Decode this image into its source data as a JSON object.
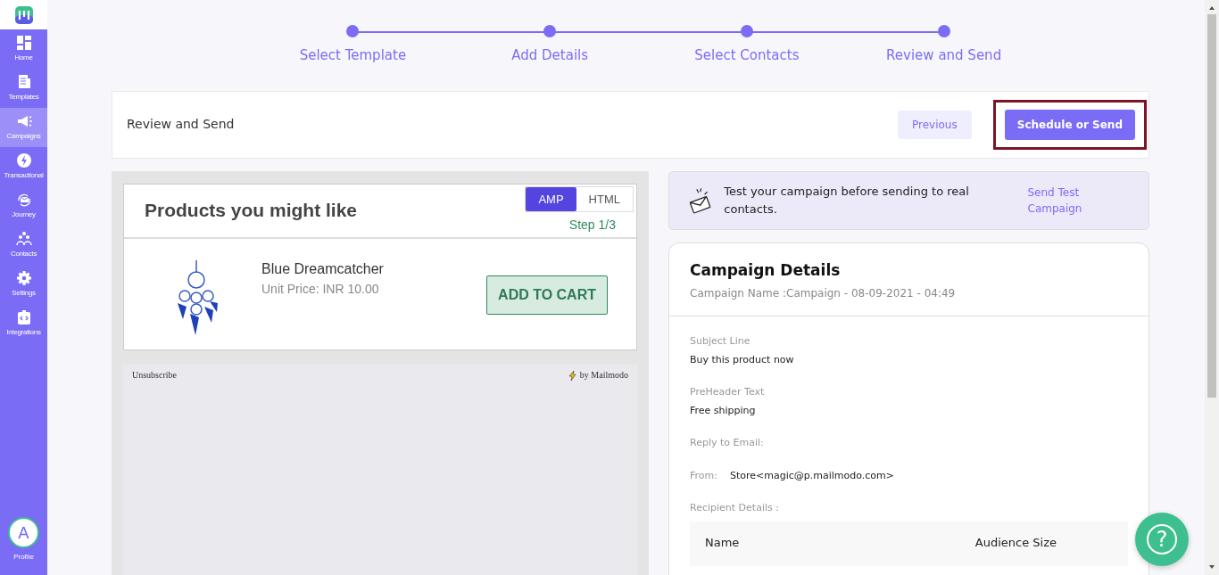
{
  "sidebar": {
    "items": [
      {
        "label": "Home",
        "selected": false
      },
      {
        "label": "Templates",
        "selected": false
      },
      {
        "label": "Campaigns",
        "selected": true
      },
      {
        "label": "Transactional",
        "selected": false
      },
      {
        "label": "Journey",
        "selected": false
      },
      {
        "label": "Contacts",
        "selected": false
      },
      {
        "label": "Settings",
        "selected": false
      },
      {
        "label": "Integrations",
        "selected": false
      }
    ],
    "profile": {
      "initial": "A",
      "label": "Profile"
    }
  },
  "stepper": [
    {
      "label": "Select Template"
    },
    {
      "label": "Add Details"
    },
    {
      "label": "Select Contacts"
    },
    {
      "label": "Review and Send"
    }
  ],
  "header": {
    "title": "Review and Send",
    "buttons": [
      {
        "label": "Previous",
        "kind": "secondary"
      },
      {
        "label": "Schedule or Send",
        "kind": "primary"
      }
    ]
  },
  "preview": {
    "toggle": [
      {
        "label": "AMP",
        "selected": true
      },
      {
        "label": "HTML",
        "selected": false
      }
    ],
    "title": "Products you might like",
    "step": "Step 1/3",
    "product": {
      "name": "Blue Dreamcatcher",
      "price": "Unit Price: INR 10.00",
      "button": "ADD TO CART"
    },
    "footer": {
      "unsubscribe": "Unsubscribe",
      "brand": "by Mailmodo"
    }
  },
  "test_banner": {
    "text": "Test your campaign before sending to real contacts.",
    "link": "Send Test Campaign"
  },
  "details": {
    "title": "Campaign Details",
    "subtitle": "Campaign Name :Campaign - 08-09-2021 - 04:49",
    "fields": [
      {
        "label": "Subject Line",
        "value": "Buy this product now",
        "kind": "stacked"
      },
      {
        "label": "PreHeader Text",
        "value": "Free shipping",
        "kind": "stacked"
      },
      {
        "label": "Reply to Email:",
        "kind": "stacked"
      },
      {
        "label": "From:",
        "value": "Store<magic@p.mailmodo.com>",
        "kind": "inline"
      }
    ],
    "recipients_label": "Recipient Details :",
    "columns": [
      "Name",
      "Audience Size"
    ]
  },
  "help_button": "?"
}
